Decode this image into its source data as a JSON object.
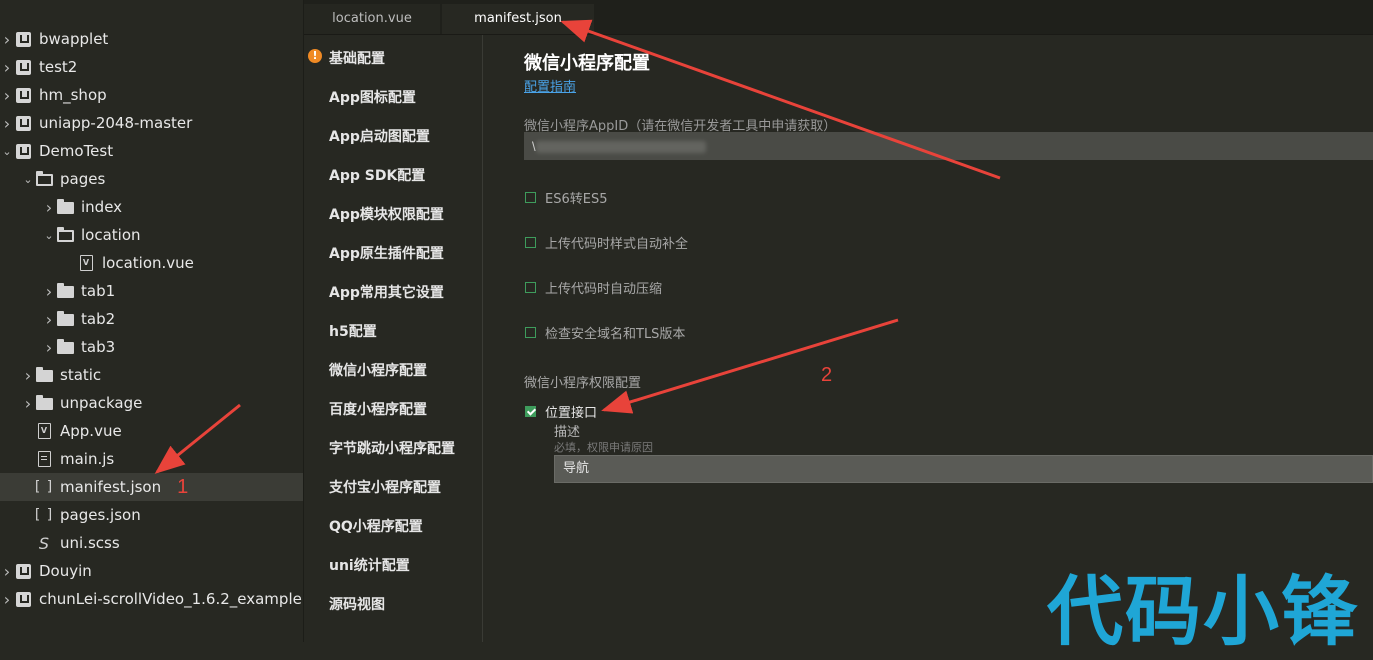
{
  "tree": [
    {
      "label": "bwapplet",
      "icon": "uni-project-icon",
      "chevron": "right",
      "depth": 0
    },
    {
      "label": "test2",
      "icon": "uni-project-icon",
      "chevron": "right",
      "depth": 0
    },
    {
      "label": "hm_shop",
      "icon": "uni-project-icon",
      "chevron": "right",
      "depth": 0
    },
    {
      "label": "uniapp-2048-master",
      "icon": "uni-project-icon",
      "chevron": "right",
      "depth": 0
    },
    {
      "label": "DemoTest",
      "icon": "uni-project-icon",
      "chevron": "down",
      "depth": 0
    },
    {
      "label": "pages",
      "icon": "folder-open-icon",
      "chevron": "down",
      "depth": 1
    },
    {
      "label": "index",
      "icon": "folder-icon",
      "chevron": "right",
      "depth": 2
    },
    {
      "label": "location",
      "icon": "folder-open-icon",
      "chevron": "down",
      "depth": 2
    },
    {
      "label": "location.vue",
      "icon": "vue-file-icon",
      "chevron": "",
      "depth": 3
    },
    {
      "label": "tab1",
      "icon": "folder-icon",
      "chevron": "right",
      "depth": 2
    },
    {
      "label": "tab2",
      "icon": "folder-icon",
      "chevron": "right",
      "depth": 2
    },
    {
      "label": "tab3",
      "icon": "folder-icon",
      "chevron": "right",
      "depth": 2
    },
    {
      "label": "static",
      "icon": "folder-icon",
      "chevron": "right",
      "depth": 1
    },
    {
      "label": "unpackage",
      "icon": "folder-icon",
      "chevron": "right",
      "depth": 1
    },
    {
      "label": "App.vue",
      "icon": "vue-file-icon",
      "chevron": "",
      "depth": 1
    },
    {
      "label": "main.js",
      "icon": "js-file-icon",
      "chevron": "",
      "depth": 1
    },
    {
      "label": "manifest.json",
      "icon": "json-file-icon",
      "chevron": "",
      "depth": 1,
      "selected": true
    },
    {
      "label": "pages.json",
      "icon": "json-file-icon",
      "chevron": "",
      "depth": 1
    },
    {
      "label": "uni.scss",
      "icon": "scss-file-icon",
      "chevron": "",
      "depth": 1
    },
    {
      "label": "Douyin",
      "icon": "uni-project-icon",
      "chevron": "right",
      "depth": 0
    },
    {
      "label": "chunLei-scrollVideo_1.6.2_example",
      "icon": "uni-project-icon",
      "chevron": "right",
      "depth": 0
    }
  ],
  "annotations": {
    "one": "1",
    "two": "2"
  },
  "tabs": [
    {
      "label": "location.vue",
      "active": false
    },
    {
      "label": "manifest.json",
      "active": true
    }
  ],
  "nav": [
    "基础配置",
    "App图标配置",
    "App启动图配置",
    "App SDK配置",
    "App模块权限配置",
    "App原生插件配置",
    "App常用其它设置",
    "h5配置",
    "微信小程序配置",
    "百度小程序配置",
    "字节跳动小程序配置",
    "支付宝小程序配置",
    "QQ小程序配置",
    "uni统计配置",
    "源码视图"
  ],
  "main": {
    "title": "微信小程序配置",
    "guide_link": "配置指南",
    "appid_label": "微信小程序AppID（请在微信开发者工具中申请获取）",
    "appid_value": "\\",
    "options": [
      {
        "label": "ES6转ES5",
        "checked": false
      },
      {
        "label": "上传代码时样式自动补全",
        "checked": false
      },
      {
        "label": "上传代码时自动压缩",
        "checked": false
      },
      {
        "label": "检查安全域名和TLS版本",
        "checked": false
      }
    ],
    "permission_title": "微信小程序权限配置",
    "location_label": "位置接口",
    "location_checked": true,
    "desc_label": "描述",
    "desc_hint": "必填，权限申请原因",
    "desc_value": "导航"
  },
  "watermark": "代码小锋",
  "colors": {
    "accent": "#1fa6d6",
    "check": "#3e9c5c",
    "arrow": "#e8433a",
    "warning": "#f08a24"
  }
}
